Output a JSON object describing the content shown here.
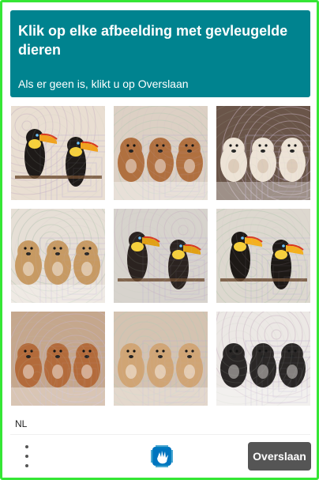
{
  "header": {
    "title": "Klik op elke afbeelding met gevleugelde dieren",
    "subtitle": "Als er geen is, klikt u op Overslaan"
  },
  "grid": [
    {
      "subject": "toucans",
      "bg": "#e9ded2",
      "animal": "#1e1a18",
      "accent": "#f2a21b"
    },
    {
      "subject": "puppies",
      "bg": "#dcd0c4",
      "animal": "#b0703f",
      "accent": "#ffffff"
    },
    {
      "subject": "puppies",
      "bg": "#6a5549",
      "animal": "#ede3d6",
      "accent": "#c9b09a"
    },
    {
      "subject": "puppies",
      "bg": "#e6dfd6",
      "animal": "#c79a63",
      "accent": "#ffffff"
    },
    {
      "subject": "toucans",
      "bg": "#d7d3cd",
      "animal": "#2b2320",
      "accent": "#e2a012"
    },
    {
      "subject": "toucans",
      "bg": "#ddd8cf",
      "animal": "#1d1916",
      "accent": "#f4b01c"
    },
    {
      "subject": "puppies",
      "bg": "#c5a78d",
      "animal": "#b36b3b",
      "accent": "#ffffff"
    },
    {
      "subject": "puppies",
      "bg": "#d4c3b1",
      "animal": "#d0a575",
      "accent": "#ffffff"
    },
    {
      "subject": "puppies",
      "bg": "#ece8e5",
      "animal": "#2a2726",
      "accent": "#f3f0ed"
    }
  ],
  "footer": {
    "language": "NL",
    "skip_label": "Overslaan"
  },
  "colors": {
    "header_bg": "#00838f",
    "frame_border": "#35e635",
    "skip_bg": "#555555"
  },
  "icons": {
    "menu": "vertical-dots-icon",
    "logo": "hcaptcha-hand-icon"
  }
}
